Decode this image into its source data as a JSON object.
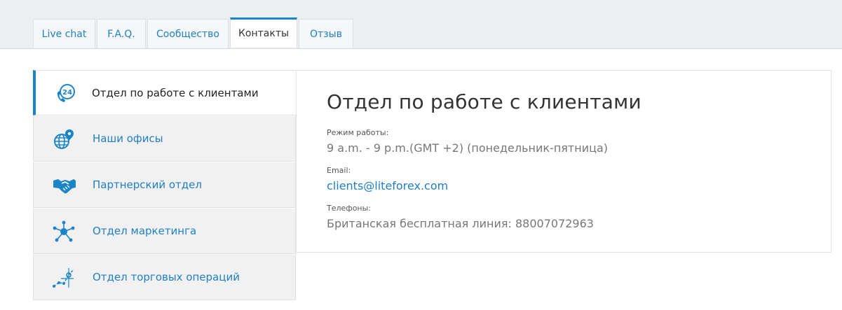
{
  "tabs": [
    {
      "label": "Live chat"
    },
    {
      "label": "F.A.Q."
    },
    {
      "label": "Сообщество"
    },
    {
      "label": "Контакты"
    },
    {
      "label": "Отзыв"
    }
  ],
  "sidebar": {
    "items": [
      {
        "label": "Отдел по работе с клиентами",
        "icon": "support-24-icon"
      },
      {
        "label": "Наши офисы",
        "icon": "globe-pin-icon"
      },
      {
        "label": "Партнерский отдел",
        "icon": "handshake-icon"
      },
      {
        "label": "Отдел маркетинга",
        "icon": "network-icon"
      },
      {
        "label": "Отдел торговых операций",
        "icon": "trading-chart-icon"
      }
    ]
  },
  "content": {
    "title": "Отдел по работе с клиентами",
    "hours_label": "Режим работы:",
    "hours_value": "9 a.m. - 9 p.m.(GMT +2) (понедельник-пятница)",
    "email_label": "Email:",
    "email_value": "clients@liteforex.com",
    "phones_label": "Телефоны:",
    "phones_value": "Британская бесплатная линия: 88007072963"
  },
  "colors": {
    "accent": "#1b84c9",
    "link": "#1f7fc4"
  }
}
